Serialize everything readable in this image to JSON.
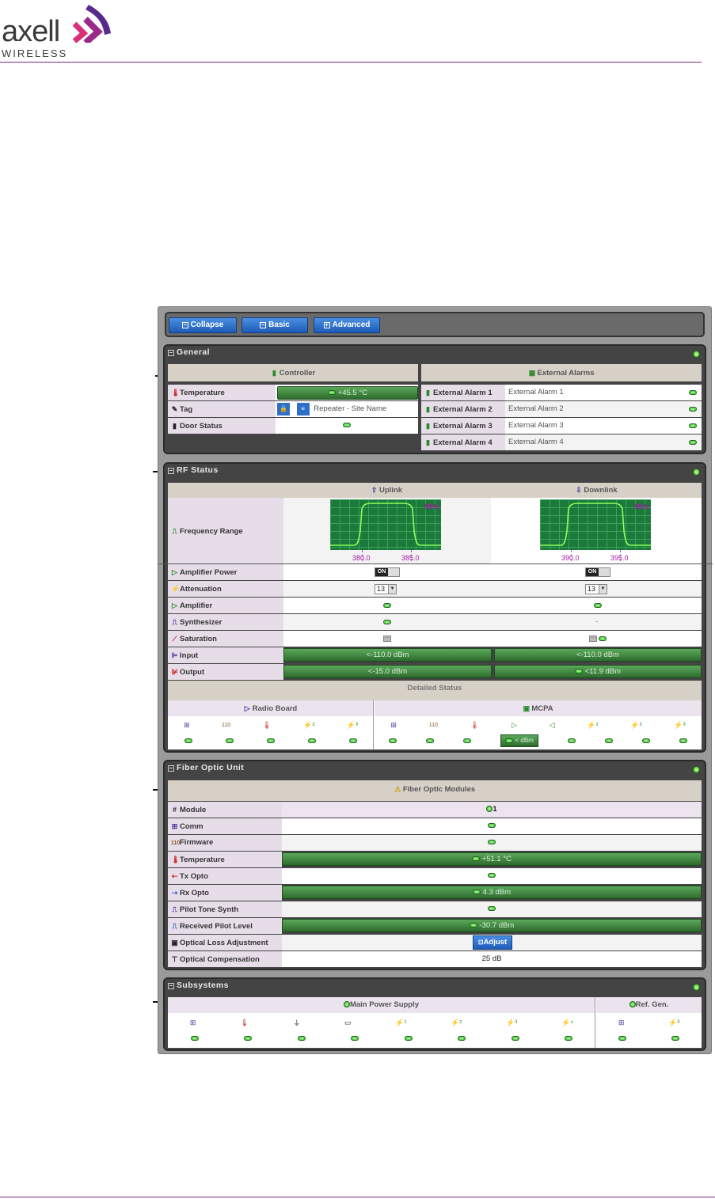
{
  "logo": {
    "brand": "axell",
    "sub": "WIRELESS"
  },
  "toolbar": {
    "collapse": "Collapse",
    "basic": "Basic",
    "advanced": "Advanced"
  },
  "general": {
    "title": "General",
    "controller_header": "Controller",
    "alarms_header": "External Alarms",
    "temperature_label": "Temperature",
    "temperature_value": "+45.5 °C",
    "tag_label": "Tag",
    "tag_value": "Repeater - Site Name",
    "door_label": "Door Status",
    "alarms": [
      {
        "label": "External Alarm 1",
        "value": "External Alarm 1"
      },
      {
        "label": "External Alarm 2",
        "value": "External Alarm 2"
      },
      {
        "label": "External Alarm 3",
        "value": "External Alarm 3"
      },
      {
        "label": "External Alarm 4",
        "value": "External Alarm 4"
      }
    ]
  },
  "rf": {
    "title": "RF Status",
    "uplink": "Uplink",
    "downlink": "Downlink",
    "freq_label": "Frequency Range",
    "mhz": "MHz",
    "uplink_low": "380.0",
    "uplink_high": "385.0",
    "downlink_low": "390.0",
    "downlink_high": "395.0",
    "amp_power_label": "Amplifier Power",
    "toggle_on": "ON",
    "attenuation_label": "Attenuation",
    "attenuation_ul": "13",
    "attenuation_dl": "13",
    "amplifier_label": "Amplifier",
    "synth_label": "Synthesizer",
    "synth_dl": "-",
    "saturation_label": "Saturation",
    "input_label": "Input",
    "input_ul": "<-110.0 dBm",
    "input_dl": "<-110.0 dBm",
    "output_label": "Output",
    "output_ul": "<-15.0 dBm",
    "output_dl": "<11.9 dBm",
    "detailed_status": "Detailed Status",
    "radio_board": "Radio Board",
    "mcpa": "MCPA",
    "mcpa_badge": "< dBm"
  },
  "fiber": {
    "title": "Fiber Optic Unit",
    "modules_header": "Fiber Optic Modules",
    "rows": {
      "module": {
        "label": "Module",
        "value": "1"
      },
      "comm": {
        "label": "Comm"
      },
      "firmware": {
        "label": "Firmware"
      },
      "temperature": {
        "label": "Temperature",
        "value": "+51.1 °C"
      },
      "tx": {
        "label": "Tx Opto"
      },
      "rx": {
        "label": "Rx Opto",
        "value": "4.3 dBm"
      },
      "pilot_synth": {
        "label": "Pilot Tone Synth"
      },
      "pilot_level": {
        "label": "Received Pilot Level",
        "value": "-30.7 dBm"
      },
      "loss_adj": {
        "label": "Optical Loss Adjustment",
        "button": "Adjust"
      },
      "compensation": {
        "label": "Optical Compensation",
        "value": "25 dB"
      }
    }
  },
  "subsystems": {
    "title": "Subsystems",
    "main_power": "Main Power Supply",
    "ref_gen": "Ref. Gen."
  },
  "colors": {
    "accent_blue": "#1d5bb8",
    "status_green": "#3dbb22",
    "header_rule": "#7a2a7a"
  }
}
